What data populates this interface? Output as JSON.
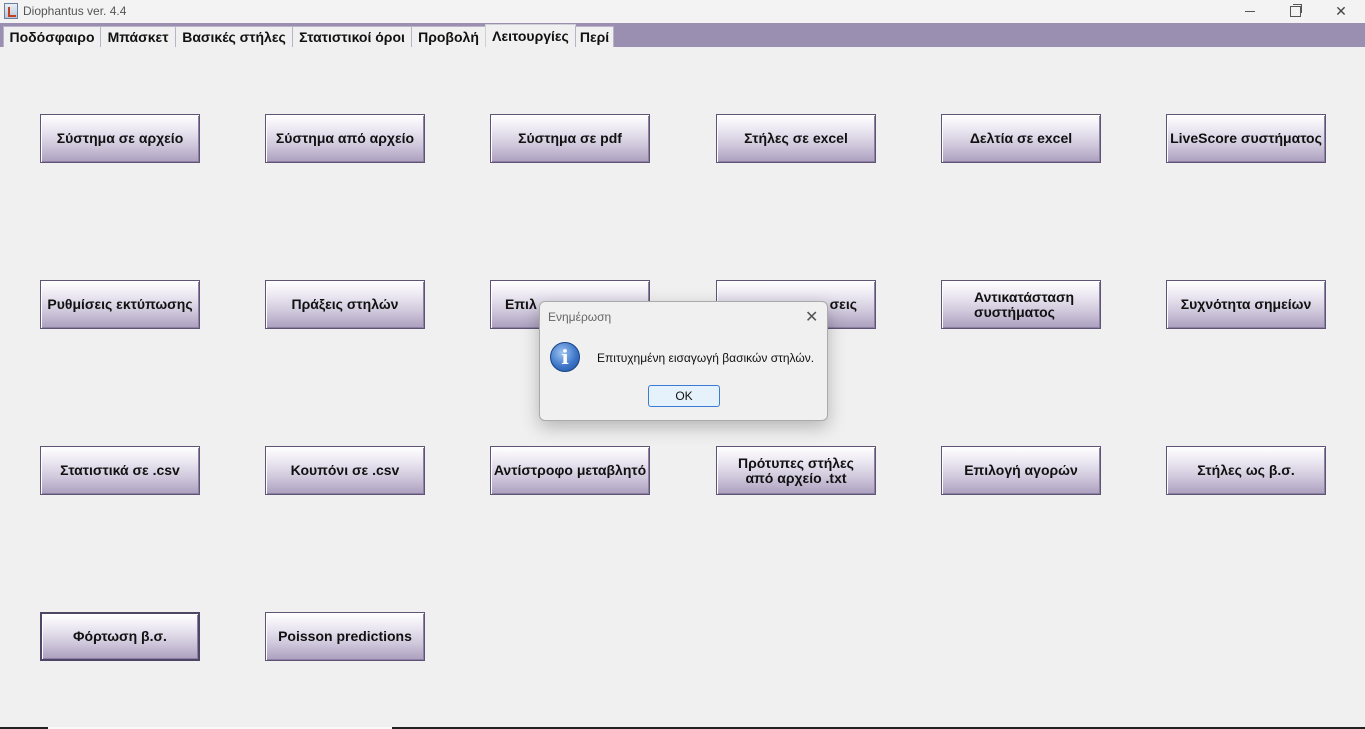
{
  "window": {
    "title": "Diophantus ver. 4.4"
  },
  "tabs": [
    {
      "label": "Ποδόσφαιρο"
    },
    {
      "label": "Μπάσκετ"
    },
    {
      "label": "Βασικές στήλες"
    },
    {
      "label": "Στατιστικοί όροι"
    },
    {
      "label": "Προβολή"
    },
    {
      "label": "Λειτουργίες"
    },
    {
      "label": "Περί"
    }
  ],
  "active_tab": "Λειτουργίες",
  "buttons": [
    {
      "label": "Σύστημα σε αρχείο"
    },
    {
      "label": "Σύστημα από αρχείο"
    },
    {
      "label": "Σύστημα σε pdf"
    },
    {
      "label": "Στήλες σε excel"
    },
    {
      "label": "Δελτία σε excel"
    },
    {
      "label": "LiveScore συστήματος"
    },
    {
      "label": "Ρυθμίσεις εκτύπωσης"
    },
    {
      "label": "Πράξεις στηλών"
    },
    {
      "label": "Επιλ"
    },
    {
      "label": "σεις"
    },
    {
      "label": "Αντικατάσταση\nσυστήματος"
    },
    {
      "label": "Συχνότητα σημείων"
    },
    {
      "label": "Στατιστικά σε .csv"
    },
    {
      "label": "Κουπόνι σε .csv"
    },
    {
      "label": "Αντίστροφο μεταβλητό"
    },
    {
      "label": "Πρότυπες στήλες\nαπό αρχείο .txt"
    },
    {
      "label": "Επιλογή αγορών"
    },
    {
      "label": "Στήλες ως β.σ."
    },
    {
      "label": "Φόρτωση β.σ."
    },
    {
      "label": "Poisson predictions"
    }
  ],
  "dialog": {
    "title": "Ενημέρωση",
    "message": "Επιτυχημένη εισαγωγή βασικών στηλών.",
    "ok_label": "OK",
    "icon": "info-icon"
  }
}
